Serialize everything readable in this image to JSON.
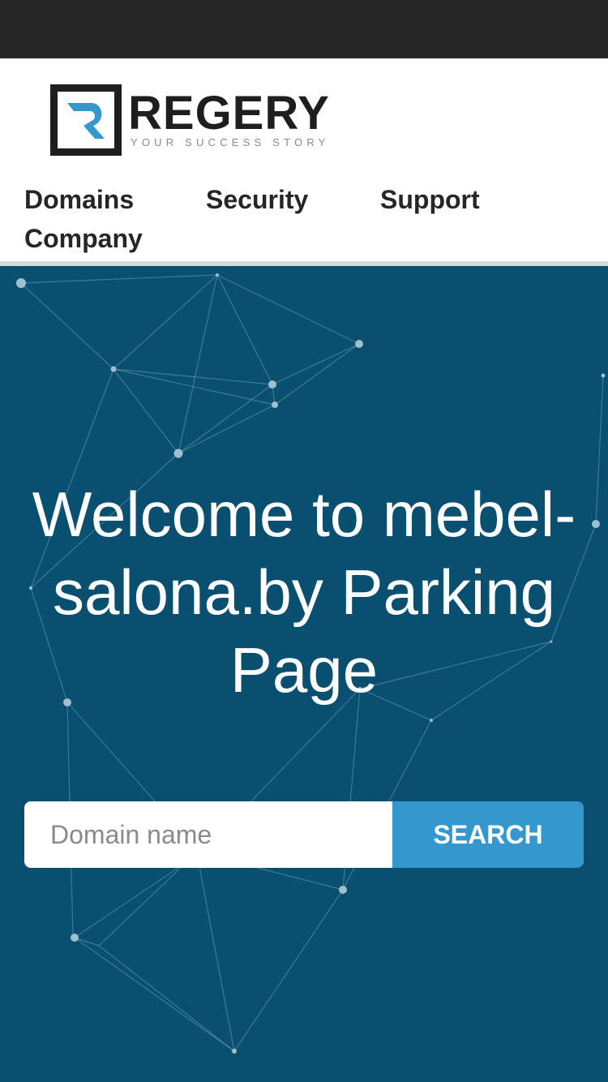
{
  "brand": {
    "name": "REGERY",
    "tagline": "YOUR SUCCESS STORY",
    "accent_color": "#3497cd",
    "dark_color": "#1e1e1e"
  },
  "nav": {
    "items": [
      {
        "label": "Domains"
      },
      {
        "label": "Security"
      },
      {
        "label": "Support"
      },
      {
        "label": "Company"
      }
    ]
  },
  "hero": {
    "title": "Welcome to mebel-salona.by Parking Page",
    "background_color": "#094f6f",
    "decoration": "network-graph"
  },
  "search": {
    "placeholder": "Domain name",
    "button_label": "SEARCH"
  }
}
